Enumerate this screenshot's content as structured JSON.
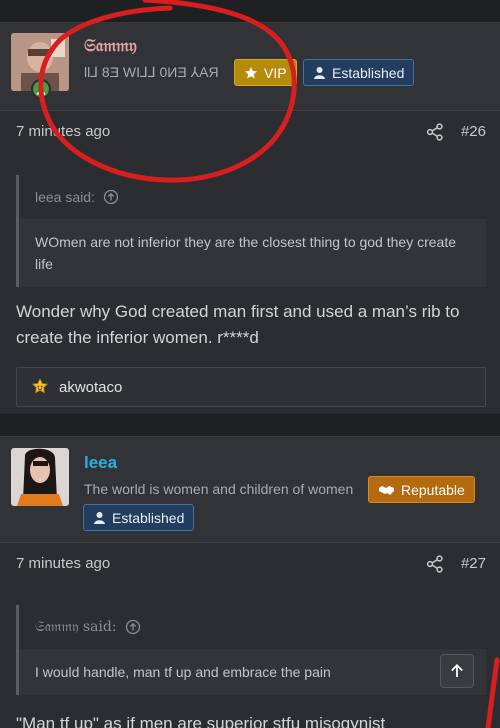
{
  "posts": [
    {
      "username": "𝔖𝔞𝔪𝔪𝔶",
      "user_title": "ƖƖ⅃ 8Ǝ WI⅃⅃ 0ИƎ ⅄AЯ",
      "badges": [
        "VIP",
        "Established"
      ],
      "time": "7 minutes ago",
      "post_number": "#26",
      "quote": {
        "author": "leea said:",
        "text": "WOmen are not inferior they are the closest thing to god they create life"
      },
      "body": "Wonder why God created man first and used a man’s rib to create the inferior women. r****d",
      "reactions": {
        "users": "akwotaco"
      }
    },
    {
      "username": "leea",
      "user_title": "The world is women and children of women",
      "badges": [
        "Reputable",
        "Established"
      ],
      "time": "7 minutes ago",
      "post_number": "#27",
      "quote": {
        "author": "𝔖𝔞𝔪𝔪𝔶 said:",
        "text": "I would handle, man tf up and embrace the pain"
      },
      "body": "\"Man tf up\" as if men are superior stfu misogynist"
    }
  ],
  "colors": {
    "username_sammy": "#e0a3a3",
    "username_leea": "#25b3e3",
    "vip": "#b58b0c",
    "established": "#233d5e",
    "reputable": "#b46a0e",
    "annotation_red": "#d81e1e"
  },
  "icons": [
    "share-icon",
    "star-icon",
    "user-icon",
    "handshake-icon",
    "arrow-circle-up-icon",
    "reaction-emoji-icon",
    "arrow-up-icon"
  ]
}
